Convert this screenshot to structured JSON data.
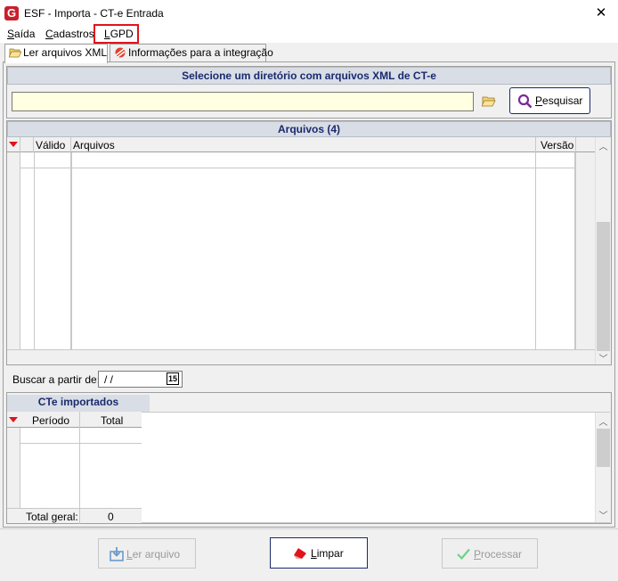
{
  "window": {
    "title": "ESF - Importa - CT-e Entrada",
    "close_glyph": "✕"
  },
  "menu": [
    {
      "label": "Saída",
      "u": "S",
      "rest": "aída"
    },
    {
      "label": "Cadastros",
      "u": "C",
      "rest": "adastros"
    },
    {
      "label": "LGPD",
      "u": "L",
      "rest": "GPD"
    }
  ],
  "tabs": [
    {
      "label": "Ler arquivos XML"
    },
    {
      "label": "Informações para a integração"
    }
  ],
  "directory_section": {
    "header": "Selecione um diretório com arquivos XML de CT-e",
    "path_value": "",
    "search_button": "Pesquisar",
    "search_underline": "P",
    "search_rest": "esquisar"
  },
  "files_section": {
    "header": "Arquivos (4)",
    "columns": [
      "Válido",
      "Arquivos",
      "Versão"
    ]
  },
  "filter": {
    "label": "Buscar a partir de:",
    "date_value": " /  /",
    "calendar_glyph": "15"
  },
  "imported_section": {
    "header": "CTe importados",
    "columns": [
      "Período",
      "Total"
    ],
    "footer_label": "Total geral:",
    "footer_value": "0"
  },
  "buttons": {
    "read": {
      "label": "Ler arquivo",
      "u": "L",
      "rest": "er arquivo"
    },
    "clear": {
      "label": "Limpar",
      "u": "L",
      "rest": "impar"
    },
    "process": {
      "label": "Processar",
      "u": "P",
      "rest": "rocessar"
    }
  },
  "colors": {
    "accent": "#1a2a6c",
    "header_bg": "#d8dde6",
    "input_bg": "#ffffe1",
    "highlight": "#e0141b"
  }
}
